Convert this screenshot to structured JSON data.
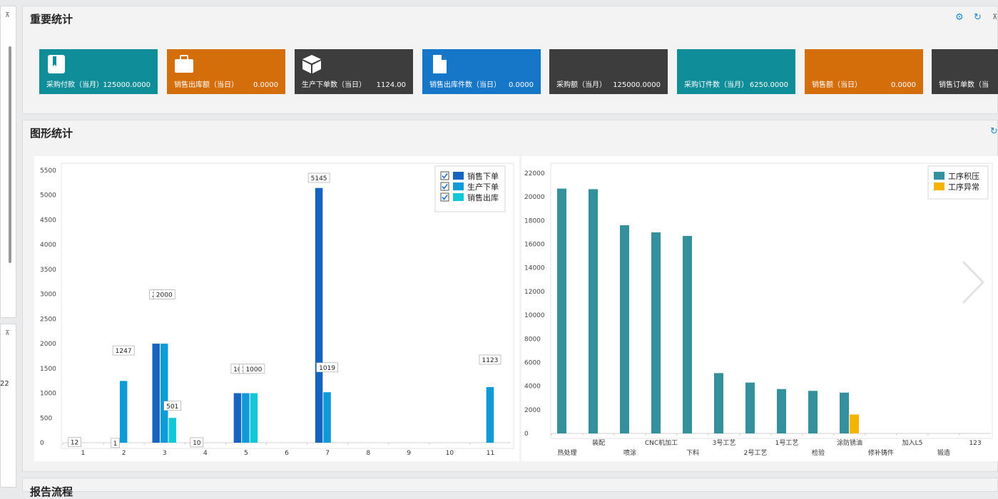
{
  "panels": {
    "stats_title": "重要统计",
    "graph_title": "图形统计",
    "bottom_title_partial": "报告流程"
  },
  "toolbar_icons": [
    "settings-icon",
    "refresh-icon",
    "pin-icon"
  ],
  "sidebar": {
    "partial_value": "22"
  },
  "cards": [
    {
      "label": "采购付款（当月）",
      "value": "125000.0000",
      "color": "#0f8e9a",
      "icon": "bookmark-icon"
    },
    {
      "label": "销售出库额（当日）",
      "value": "0.0000",
      "color": "#d46e0a",
      "icon": "briefcase-icon"
    },
    {
      "label": "生产下单数（当日）",
      "value": "1124.00",
      "color": "#3d3d3d",
      "icon": "cube-icon"
    },
    {
      "label": "销售出库件数（当日）",
      "value": "0.0000",
      "color": "#1677c9",
      "icon": "document-icon"
    },
    {
      "label": "采购额（当月）",
      "value": "125000.0000",
      "color": "#3d3d3d",
      "icon": ""
    },
    {
      "label": "采购订件数（当月）",
      "value": "6250.0000",
      "color": "#0f8e9a",
      "icon": ""
    },
    {
      "label": "销售额（当日）",
      "value": "0.0000",
      "color": "#d46e0a",
      "icon": ""
    },
    {
      "label": "销售订单数（当",
      "value": "",
      "color": "#3d3d3d",
      "icon": ""
    }
  ],
  "chart_data": [
    {
      "type": "bar",
      "categories": [
        "1",
        "2",
        "3",
        "4",
        "5",
        "6",
        "7",
        "8",
        "9",
        "10",
        "11"
      ],
      "ylim": [
        0,
        5500
      ],
      "yticks": [
        0,
        500,
        1000,
        1500,
        2000,
        2500,
        3000,
        3500,
        4000,
        4500,
        5000,
        5500
      ],
      "grid": false,
      "legend_placement": "top-right",
      "series": [
        {
          "name": "销售下单",
          "color": "#1565c0",
          "values": [
            12,
            1,
            2000,
            10,
            1000,
            0,
            5145,
            0,
            0,
            0,
            0
          ],
          "labels": [
            "12",
            "1",
            "20",
            "10",
            "10",
            "",
            "5145",
            "",
            "",
            "",
            ""
          ]
        },
        {
          "name": "生产下单",
          "color": "#0e9bd8",
          "values": [
            0,
            1247,
            2000,
            0,
            1000,
            0,
            1019,
            0,
            0,
            0,
            1123
          ],
          "labels": [
            "",
            "1247",
            "2000",
            "",
            "10",
            "",
            "1019",
            "",
            "",
            "",
            "1123"
          ]
        },
        {
          "name": "销售出库",
          "color": "#13c8d6",
          "values": [
            0,
            0,
            501,
            0,
            1000,
            0,
            0,
            0,
            0,
            0,
            0
          ],
          "labels": [
            "",
            "",
            "501",
            "",
            "1000",
            "",
            "",
            "",
            "",
            "",
            ""
          ]
        }
      ]
    },
    {
      "type": "bar",
      "categories": [
        "热处理",
        "装配",
        "喷涂",
        "CNC机加工",
        "下料",
        "3号工艺",
        "2号工艺",
        "1号工艺",
        "检验",
        "涂防锈油",
        "修补铸件",
        "加入L5",
        "锻造",
        "123"
      ],
      "ylim": [
        0,
        22000
      ],
      "yticks": [
        0,
        2000,
        4000,
        6000,
        8000,
        10000,
        12000,
        14000,
        16000,
        18000,
        20000,
        22000
      ],
      "grid": false,
      "legend_placement": "top-right",
      "series": [
        {
          "name": "工序积压",
          "color": "#35909e",
          "values": [
            20700,
            20650,
            17600,
            17000,
            16700,
            5100,
            4300,
            3750,
            3600,
            3450,
            0,
            0,
            0,
            0
          ]
        },
        {
          "name": "工序异常",
          "color": "#f5b400",
          "values": [
            0,
            0,
            0,
            0,
            0,
            0,
            0,
            0,
            0,
            1600,
            0,
            0,
            0,
            0
          ]
        }
      ]
    }
  ]
}
